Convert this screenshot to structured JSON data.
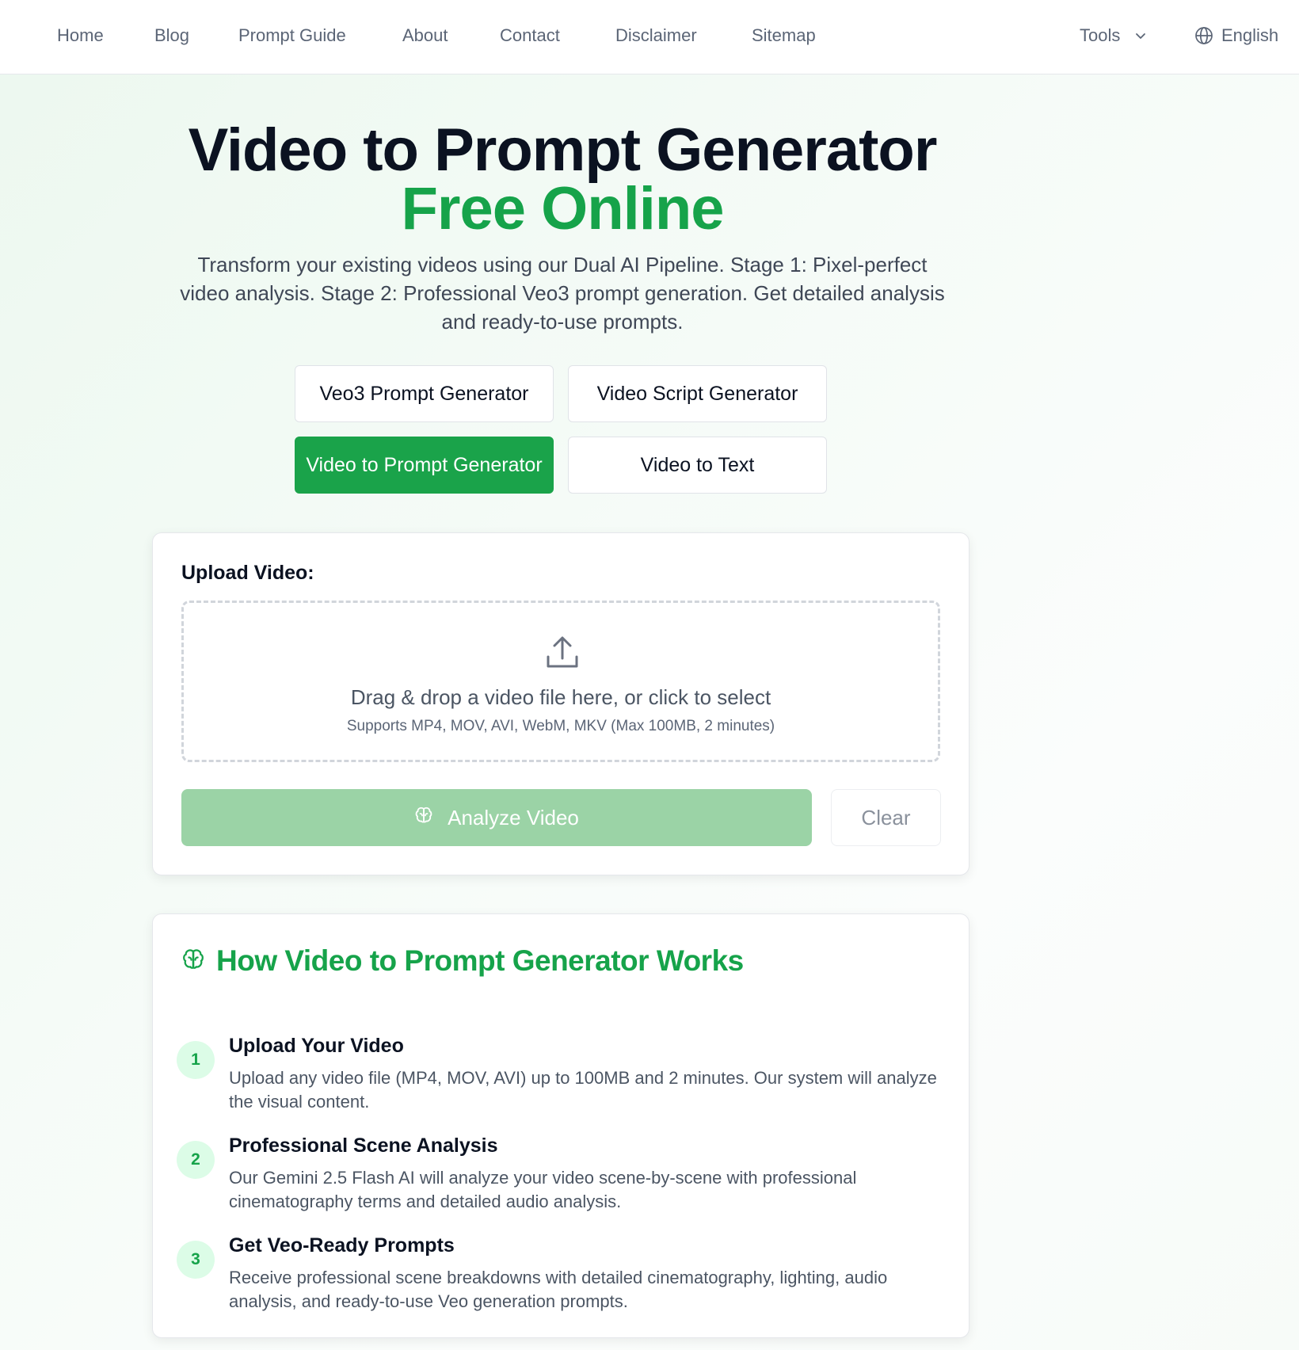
{
  "nav": {
    "links": [
      "Home",
      "Blog",
      "Prompt Guide",
      "About",
      "Contact",
      "Disclaimer",
      "Sitemap"
    ],
    "tools_label": "Tools",
    "language_label": "English",
    "icons": {
      "tools": "chevron-down-icon",
      "language": "globe-icon"
    }
  },
  "hero": {
    "title_main": "Video to Prompt Generator",
    "title_accent": "Free Online",
    "description": "Transform your existing videos using our Dual AI Pipeline. Stage 1: Pixel-perfect video analysis. Stage 2: Professional Veo3 prompt generation. Get detailed analysis and ready-to-use prompts."
  },
  "tools": [
    {
      "label": "Veo3 Prompt Generator",
      "active": false
    },
    {
      "label": "Video Script Generator",
      "active": false
    },
    {
      "label": "Video to Prompt Generator",
      "active": true
    },
    {
      "label": "Video to Text",
      "active": false
    }
  ],
  "upload": {
    "label": "Upload Video:",
    "dropzone_text": "Drag & drop a video file here, or click to select",
    "dropzone_subtext": "Supports MP4, MOV, AVI, WebM, MKV (Max 100MB, 2 minutes)",
    "analyze_label": "Analyze Video",
    "clear_label": "Clear",
    "icons": {
      "dropzone": "upload-icon",
      "analyze": "brain-icon"
    }
  },
  "how": {
    "title": "How Video to Prompt Generator Works",
    "icon": "brain-icon",
    "steps": [
      {
        "num": "1",
        "title": "Upload Your Video",
        "desc": "Upload any video file (MP4, MOV, AVI) up to 100MB and 2 minutes. Our system will analyze the visual content."
      },
      {
        "num": "2",
        "title": "Professional Scene Analysis",
        "desc": "Our Gemini 2.5 Flash AI will analyze your video scene-by-scene with professional cinematography terms and detailed audio analysis."
      },
      {
        "num": "3",
        "title": "Get Veo-Ready Prompts",
        "desc": "Receive professional scene breakdowns with detailed cinematography, lighting, audio analysis, and ready-to-use Veo generation prompts."
      }
    ]
  },
  "colors": {
    "accent": "#16a34a",
    "accent_light": "#dcfce7",
    "analyze_disabled": "#9bd3a6",
    "heading": "#0b1221"
  }
}
